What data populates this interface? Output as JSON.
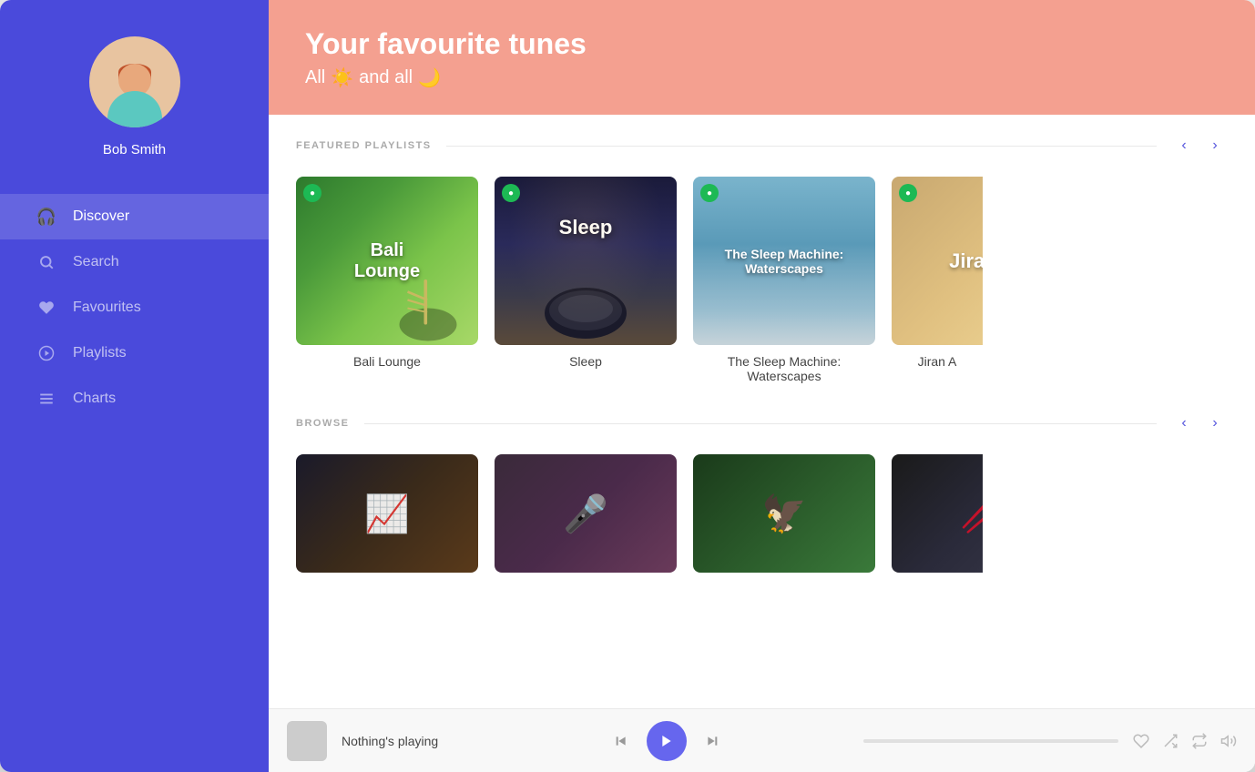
{
  "sidebar": {
    "user_name": "Bob Smith",
    "nav_items": [
      {
        "id": "discover",
        "label": "Discover",
        "icon": "🎧",
        "active": true
      },
      {
        "id": "search",
        "label": "Search",
        "icon": "🔍",
        "active": false
      },
      {
        "id": "favourites",
        "label": "Favourites",
        "icon": "♥",
        "active": false
      },
      {
        "id": "playlists",
        "label": "Playlists",
        "icon": "▶",
        "active": false
      },
      {
        "id": "charts",
        "label": "Charts",
        "icon": "☰",
        "active": false
      }
    ]
  },
  "header": {
    "title": "Your favourite tunes",
    "subtitle_pre": "All",
    "subtitle_sun": "☀",
    "subtitle_mid": "and all",
    "subtitle_moon": "🌙"
  },
  "featured_section": {
    "title": "FEATURED PLAYLISTS",
    "cards": [
      {
        "id": "bali-lounge",
        "title": "Bali Lounge",
        "label": "Bali Lounge",
        "style": "bali"
      },
      {
        "id": "sleep",
        "title": "Sleep",
        "label": "Sleep",
        "style": "sleep"
      },
      {
        "id": "waterscapes",
        "title": "The Sleep Machine: Waterscapes",
        "label": "The Sleep Machine: Waterscapes",
        "style": "water"
      },
      {
        "id": "jiran",
        "title": "Jiran A",
        "label": "Jiran A",
        "style": "jiran"
      }
    ]
  },
  "browse_section": {
    "title": "BROWSE",
    "cards": [
      {
        "id": "trending",
        "icon": "📈",
        "style": "trending"
      },
      {
        "id": "pop",
        "icon": "🎤",
        "style": "pop"
      },
      {
        "id": "nature",
        "icon": "🦅",
        "style": "nature"
      },
      {
        "id": "ambient",
        "icon": "🥢",
        "style": "ambient"
      }
    ]
  },
  "player": {
    "track_label": "Nothing's playing",
    "progress": 0,
    "play_icon": "▶"
  }
}
